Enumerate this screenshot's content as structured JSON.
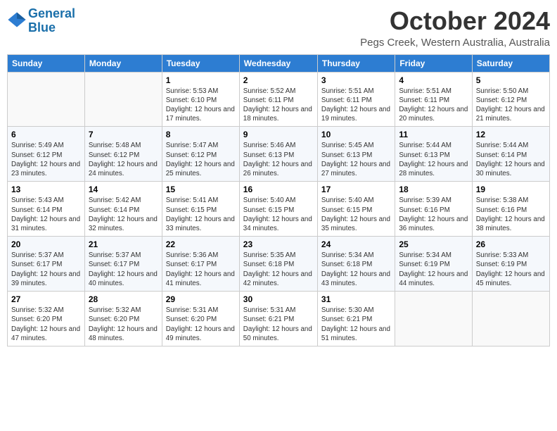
{
  "logo": {
    "line1": "General",
    "line2": "Blue"
  },
  "title": "October 2024",
  "location": "Pegs Creek, Western Australia, Australia",
  "headers": [
    "Sunday",
    "Monday",
    "Tuesday",
    "Wednesday",
    "Thursday",
    "Friday",
    "Saturday"
  ],
  "weeks": [
    [
      {
        "day": "",
        "detail": ""
      },
      {
        "day": "",
        "detail": ""
      },
      {
        "day": "1",
        "detail": "Sunrise: 5:53 AM\nSunset: 6:10 PM\nDaylight: 12 hours and 17 minutes."
      },
      {
        "day": "2",
        "detail": "Sunrise: 5:52 AM\nSunset: 6:11 PM\nDaylight: 12 hours and 18 minutes."
      },
      {
        "day": "3",
        "detail": "Sunrise: 5:51 AM\nSunset: 6:11 PM\nDaylight: 12 hours and 19 minutes."
      },
      {
        "day": "4",
        "detail": "Sunrise: 5:51 AM\nSunset: 6:11 PM\nDaylight: 12 hours and 20 minutes."
      },
      {
        "day": "5",
        "detail": "Sunrise: 5:50 AM\nSunset: 6:12 PM\nDaylight: 12 hours and 21 minutes."
      }
    ],
    [
      {
        "day": "6",
        "detail": "Sunrise: 5:49 AM\nSunset: 6:12 PM\nDaylight: 12 hours and 23 minutes."
      },
      {
        "day": "7",
        "detail": "Sunrise: 5:48 AM\nSunset: 6:12 PM\nDaylight: 12 hours and 24 minutes."
      },
      {
        "day": "8",
        "detail": "Sunrise: 5:47 AM\nSunset: 6:12 PM\nDaylight: 12 hours and 25 minutes."
      },
      {
        "day": "9",
        "detail": "Sunrise: 5:46 AM\nSunset: 6:13 PM\nDaylight: 12 hours and 26 minutes."
      },
      {
        "day": "10",
        "detail": "Sunrise: 5:45 AM\nSunset: 6:13 PM\nDaylight: 12 hours and 27 minutes."
      },
      {
        "day": "11",
        "detail": "Sunrise: 5:44 AM\nSunset: 6:13 PM\nDaylight: 12 hours and 28 minutes."
      },
      {
        "day": "12",
        "detail": "Sunrise: 5:44 AM\nSunset: 6:14 PM\nDaylight: 12 hours and 30 minutes."
      }
    ],
    [
      {
        "day": "13",
        "detail": "Sunrise: 5:43 AM\nSunset: 6:14 PM\nDaylight: 12 hours and 31 minutes."
      },
      {
        "day": "14",
        "detail": "Sunrise: 5:42 AM\nSunset: 6:14 PM\nDaylight: 12 hours and 32 minutes."
      },
      {
        "day": "15",
        "detail": "Sunrise: 5:41 AM\nSunset: 6:15 PM\nDaylight: 12 hours and 33 minutes."
      },
      {
        "day": "16",
        "detail": "Sunrise: 5:40 AM\nSunset: 6:15 PM\nDaylight: 12 hours and 34 minutes."
      },
      {
        "day": "17",
        "detail": "Sunrise: 5:40 AM\nSunset: 6:15 PM\nDaylight: 12 hours and 35 minutes."
      },
      {
        "day": "18",
        "detail": "Sunrise: 5:39 AM\nSunset: 6:16 PM\nDaylight: 12 hours and 36 minutes."
      },
      {
        "day": "19",
        "detail": "Sunrise: 5:38 AM\nSunset: 6:16 PM\nDaylight: 12 hours and 38 minutes."
      }
    ],
    [
      {
        "day": "20",
        "detail": "Sunrise: 5:37 AM\nSunset: 6:17 PM\nDaylight: 12 hours and 39 minutes."
      },
      {
        "day": "21",
        "detail": "Sunrise: 5:37 AM\nSunset: 6:17 PM\nDaylight: 12 hours and 40 minutes."
      },
      {
        "day": "22",
        "detail": "Sunrise: 5:36 AM\nSunset: 6:17 PM\nDaylight: 12 hours and 41 minutes."
      },
      {
        "day": "23",
        "detail": "Sunrise: 5:35 AM\nSunset: 6:18 PM\nDaylight: 12 hours and 42 minutes."
      },
      {
        "day": "24",
        "detail": "Sunrise: 5:34 AM\nSunset: 6:18 PM\nDaylight: 12 hours and 43 minutes."
      },
      {
        "day": "25",
        "detail": "Sunrise: 5:34 AM\nSunset: 6:19 PM\nDaylight: 12 hours and 44 minutes."
      },
      {
        "day": "26",
        "detail": "Sunrise: 5:33 AM\nSunset: 6:19 PM\nDaylight: 12 hours and 45 minutes."
      }
    ],
    [
      {
        "day": "27",
        "detail": "Sunrise: 5:32 AM\nSunset: 6:20 PM\nDaylight: 12 hours and 47 minutes."
      },
      {
        "day": "28",
        "detail": "Sunrise: 5:32 AM\nSunset: 6:20 PM\nDaylight: 12 hours and 48 minutes."
      },
      {
        "day": "29",
        "detail": "Sunrise: 5:31 AM\nSunset: 6:20 PM\nDaylight: 12 hours and 49 minutes."
      },
      {
        "day": "30",
        "detail": "Sunrise: 5:31 AM\nSunset: 6:21 PM\nDaylight: 12 hours and 50 minutes."
      },
      {
        "day": "31",
        "detail": "Sunrise: 5:30 AM\nSunset: 6:21 PM\nDaylight: 12 hours and 51 minutes."
      },
      {
        "day": "",
        "detail": ""
      },
      {
        "day": "",
        "detail": ""
      }
    ]
  ]
}
